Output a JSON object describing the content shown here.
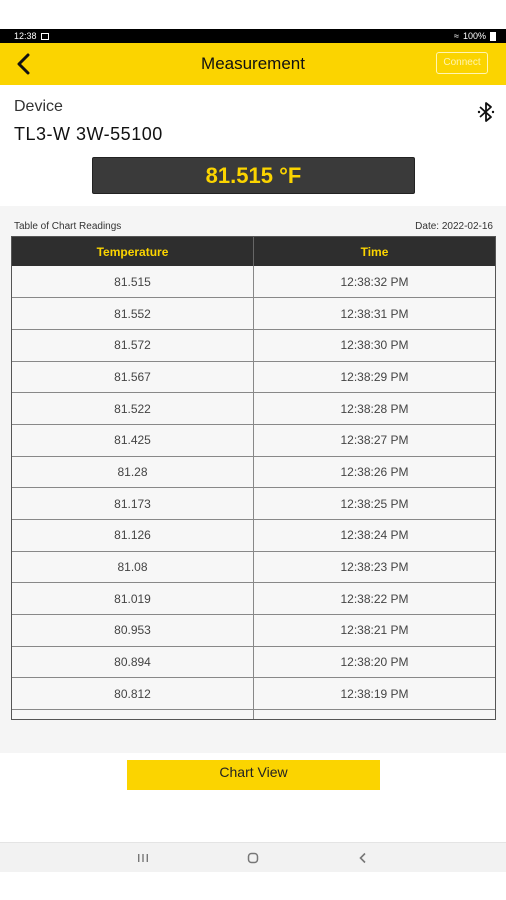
{
  "status_bar": {
    "time": "12:38",
    "battery": "100%"
  },
  "app_bar": {
    "title": "Measurement",
    "connect_label": "Connect"
  },
  "device": {
    "label": "Device",
    "name": "TL3-W 3W-55100"
  },
  "current_reading": "81.515 °F",
  "table": {
    "caption": "Table of Chart Readings",
    "date": "Date: 2022-02-16",
    "headers": [
      "Temperature",
      "Time"
    ],
    "rows": [
      [
        "81.515",
        "12:38:32 PM"
      ],
      [
        "81.552",
        "12:38:31 PM"
      ],
      [
        "81.572",
        "12:38:30 PM"
      ],
      [
        "81.567",
        "12:38:29 PM"
      ],
      [
        "81.522",
        "12:38:28 PM"
      ],
      [
        "81.425",
        "12:38:27 PM"
      ],
      [
        "81.28",
        "12:38:26 PM"
      ],
      [
        "81.173",
        "12:38:25 PM"
      ],
      [
        "81.126",
        "12:38:24 PM"
      ],
      [
        "81.08",
        "12:38:23 PM"
      ],
      [
        "81.019",
        "12:38:22 PM"
      ],
      [
        "80.953",
        "12:38:21 PM"
      ],
      [
        "80.894",
        "12:38:20 PM"
      ],
      [
        "80.812",
        "12:38:19 PM"
      ],
      [
        "",
        ""
      ]
    ]
  },
  "chart_view_label": "Chart View",
  "colors": {
    "accent": "#fbd400",
    "header_dark": "#2e2e2e",
    "reading_bg": "#3a3a3a"
  },
  "icons": {
    "back": "chevron-left-icon",
    "bluetooth": "bluetooth-icon",
    "nav_recents": "recents-icon",
    "nav_home": "home-icon",
    "nav_back": "nav-back-icon"
  }
}
